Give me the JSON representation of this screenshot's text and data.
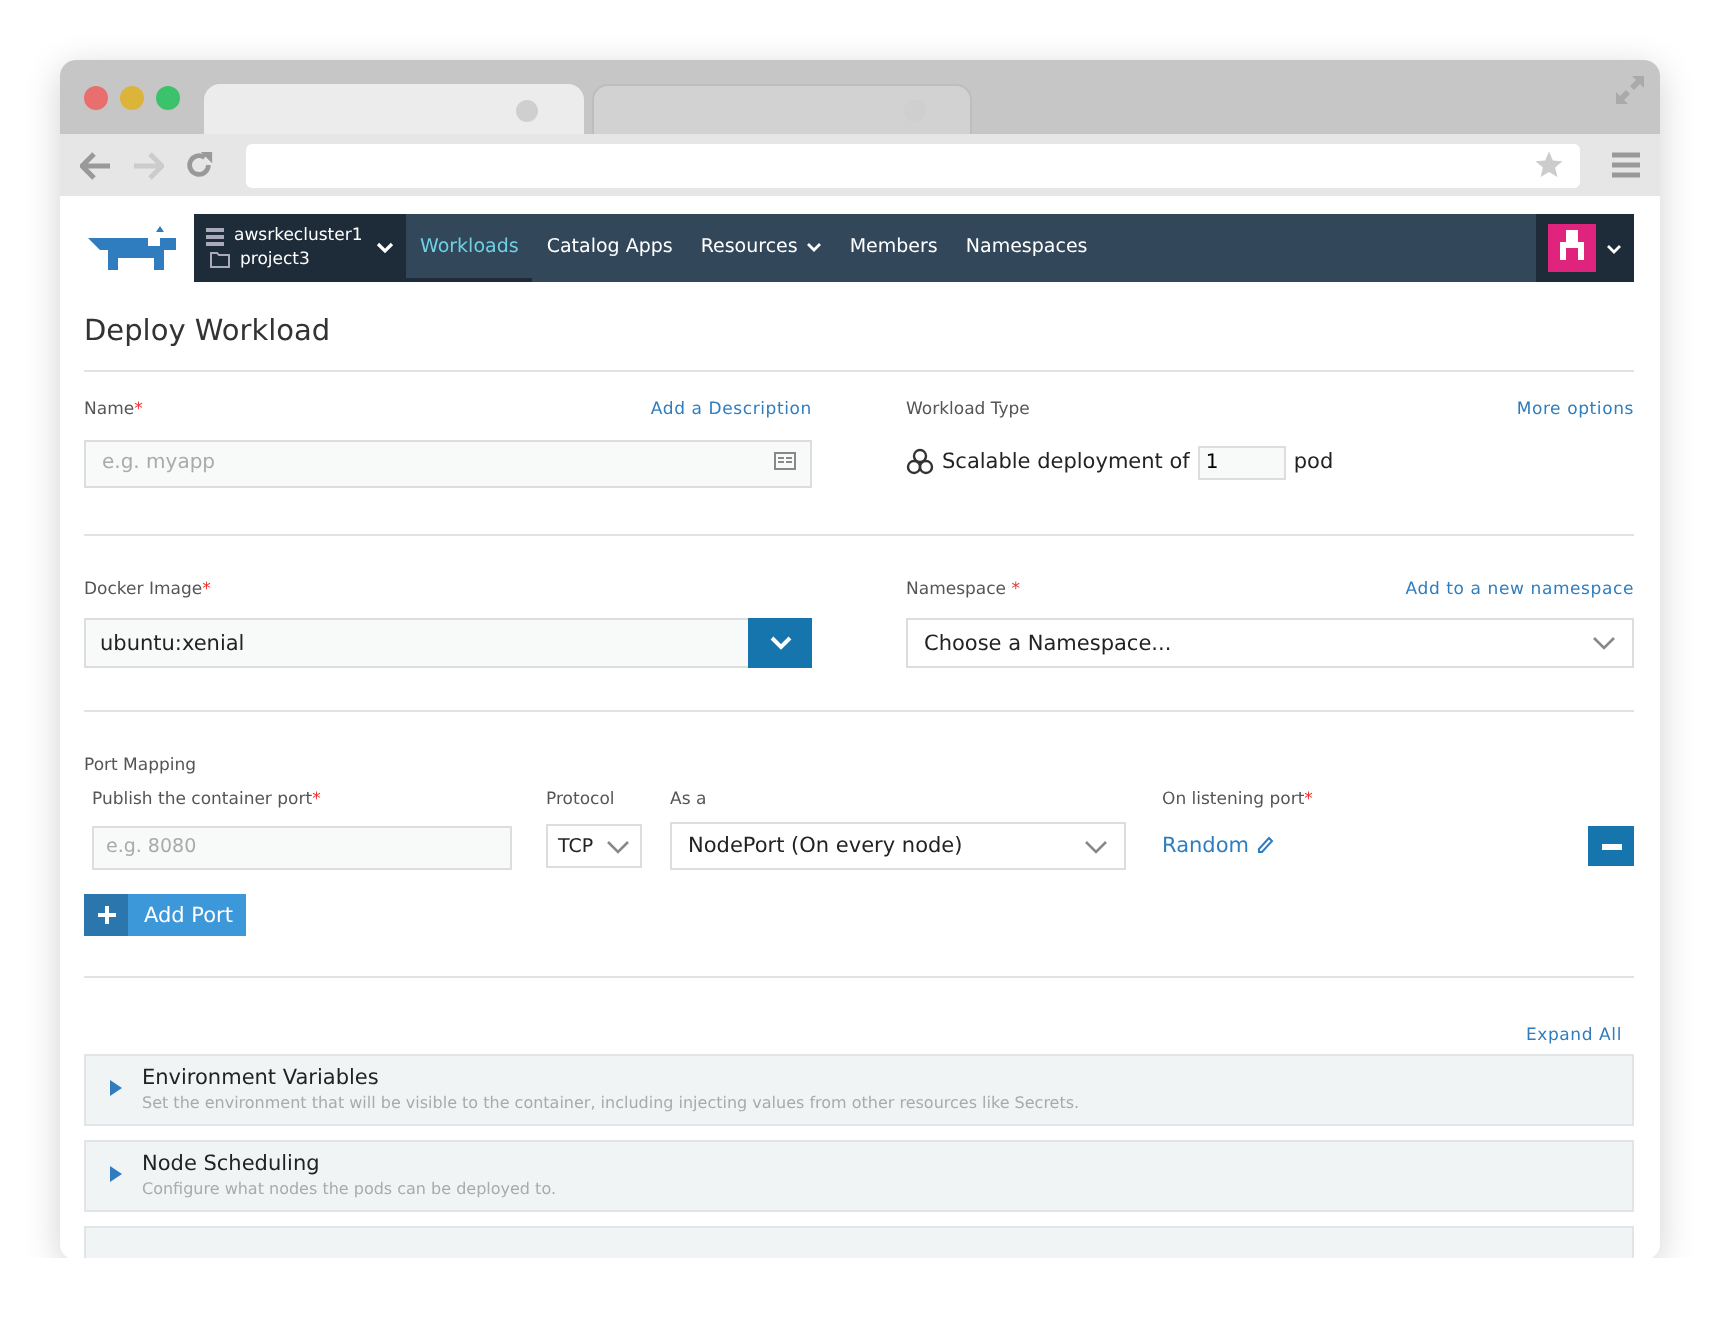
{
  "browser": {
    "tabs": [
      {
        "selected": true
      },
      {
        "selected": false
      }
    ]
  },
  "nav": {
    "cluster": "awsrkecluster1",
    "project": "project3",
    "items": [
      {
        "label": "Workloads",
        "selected": true,
        "has_menu": false
      },
      {
        "label": "Catalog Apps",
        "selected": false,
        "has_menu": false
      },
      {
        "label": "Resources",
        "selected": false,
        "has_menu": true
      },
      {
        "label": "Members",
        "selected": false,
        "has_menu": false
      },
      {
        "label": "Namespaces",
        "selected": false,
        "has_menu": false
      }
    ]
  },
  "title": "Deploy Workload",
  "name_field": {
    "label": "Name",
    "required_mark": "*",
    "link": "Add a Description",
    "placeholder": "e.g. myapp"
  },
  "workload_type": {
    "label": "Workload Type",
    "link": "More options",
    "text": "Scalable deployment of",
    "value": "1",
    "unit": "pod"
  },
  "docker_image": {
    "label": "Docker Image",
    "required_mark": "*",
    "value": "ubuntu:xenial"
  },
  "namespace": {
    "label": "Namespace",
    "required_mark": "*",
    "link": "Add to a new namespace",
    "value": "Choose a Namespace..."
  },
  "port_mapping": {
    "title": "Port Mapping",
    "columns": [
      {
        "label": "Publish the container port",
        "required_mark": "*"
      },
      {
        "label": "Protocol"
      },
      {
        "label": "As a"
      },
      {
        "label": "On listening port",
        "required_mark": "*"
      }
    ],
    "rows": [
      {
        "placeholder": "e.g. 8080",
        "protocol": "TCP",
        "as": "NodePort (On every node)",
        "listening_port": "Random"
      }
    ],
    "add_button": "Add Port"
  },
  "expand_all": "Expand All",
  "sections": [
    {
      "title": "Environment Variables",
      "description": "Set the environment that will be visible to the container, including injecting values from other resources like Secrets.",
      "expanded": false
    },
    {
      "title": "Node Scheduling",
      "description": "Configure what nodes the pods can be deployed to.",
      "expanded": false
    }
  ]
}
